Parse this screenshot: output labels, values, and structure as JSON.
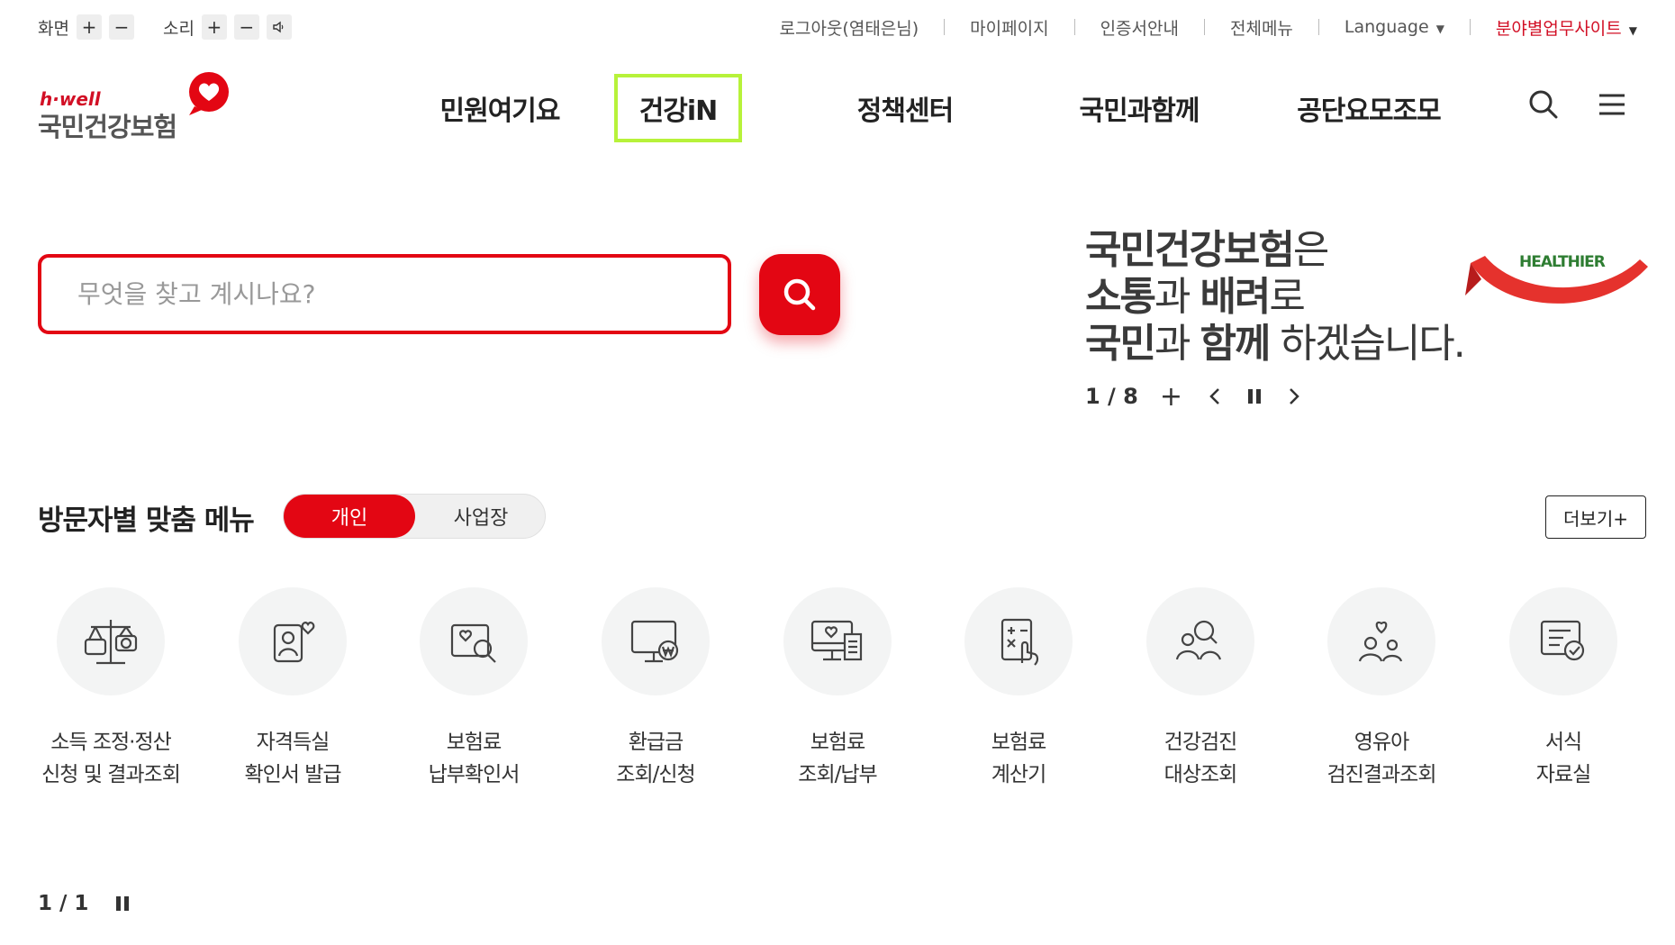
{
  "utility": {
    "screen_label": "화면",
    "sound_label": "소리",
    "plus": "+",
    "minus": "−",
    "links": [
      "로그아웃(염태은님)",
      "마이페이지",
      "인증서안내",
      "전체메뉴",
      "Language",
      "분야별업무사이트"
    ]
  },
  "logo": {
    "brand_en": "h·well",
    "brand_ko": "국민건강보험"
  },
  "nav": {
    "items": [
      "민원여기요",
      "건강iN",
      "정책센터",
      "국민과함께",
      "공단요모조모"
    ]
  },
  "search": {
    "placeholder": "무엇을 찾고 계시나요?"
  },
  "banner": {
    "line1_bold": "국민건강보험",
    "line1_rest": "은",
    "line2_b1": "소통",
    "line2_t1": "과 ",
    "line2_b2": "배려",
    "line2_t2": "로",
    "line3_b1": "국민",
    "line3_t1": "과 ",
    "line3_b2": "함께",
    "line3_t2": " 하겠습니다.",
    "ribbon_text": "HEALTHIER",
    "counter": "1 / 8",
    "plus": "+"
  },
  "visitor": {
    "title": "방문자별 맞춤 메뉴",
    "toggle": [
      "개인",
      "사업장"
    ],
    "more": "더보기+",
    "items": [
      {
        "line1": "소득 조정·정산",
        "line2": "신청 및 결과조회",
        "icon": "scale-icon"
      },
      {
        "line1": "자격득실",
        "line2": "확인서 발급",
        "icon": "person-heart-icon"
      },
      {
        "line1": "보험료",
        "line2": "납부확인서",
        "icon": "document-search-icon"
      },
      {
        "line1": "환급금",
        "line2": "조회/신청",
        "icon": "monitor-won-icon"
      },
      {
        "line1": "보험료",
        "line2": "조회/납부",
        "icon": "monitor-receipt-icon"
      },
      {
        "line1": "보험료",
        "line2": "계산기",
        "icon": "calculator-icon"
      },
      {
        "line1": "건강검진",
        "line2": "대상조회",
        "icon": "people-search-icon"
      },
      {
        "line1": "영유아",
        "line2": "검진결과조회",
        "icon": "family-heart-icon"
      },
      {
        "line1": "서식",
        "line2": "자료실",
        "icon": "form-check-icon"
      }
    ],
    "pager": "1 / 1"
  },
  "colors": {
    "accent": "#e30613",
    "focus": "#b7f23a",
    "text": "#222222"
  }
}
